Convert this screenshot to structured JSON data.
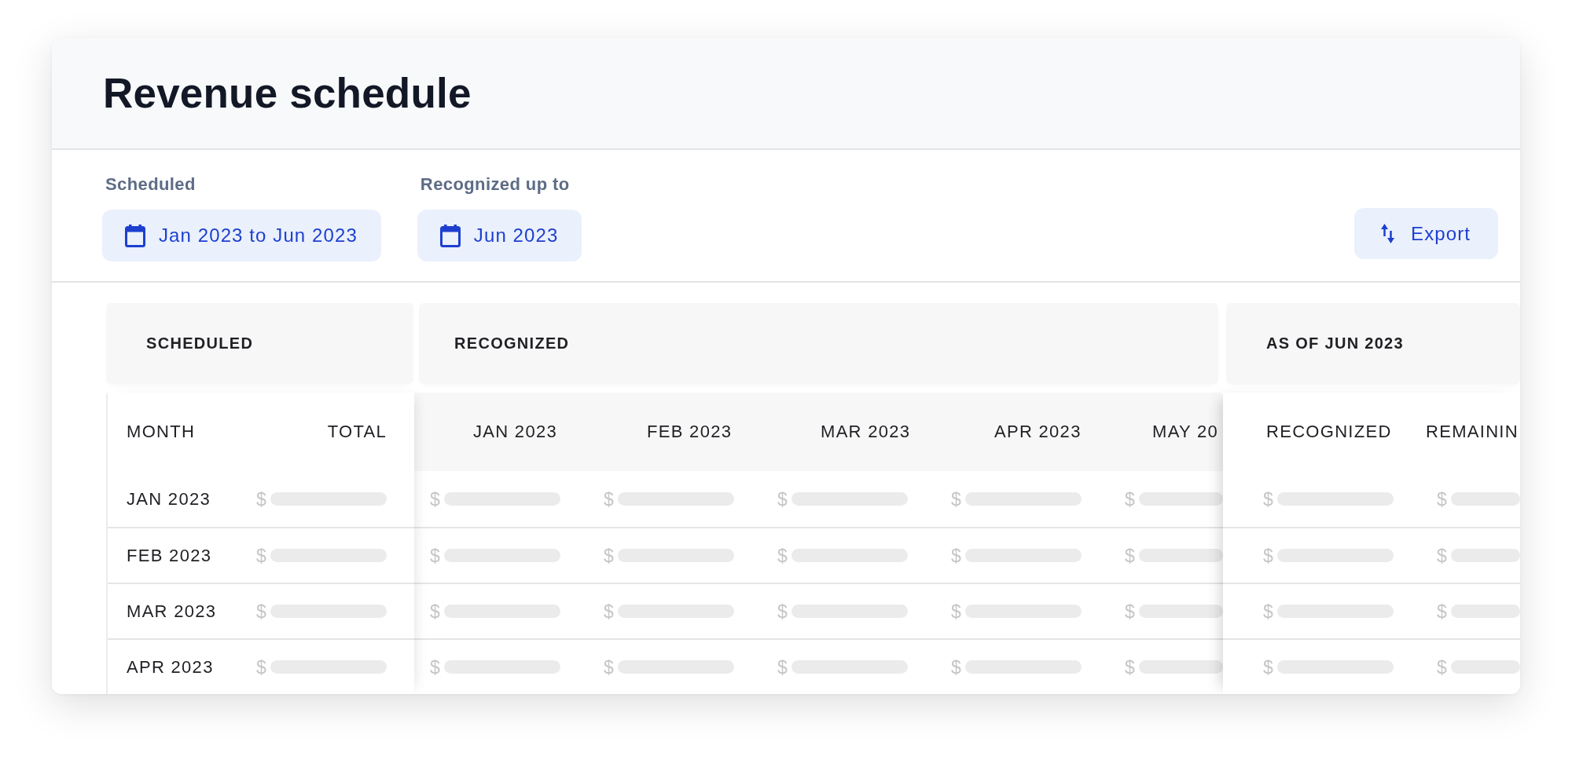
{
  "title": "Revenue schedule",
  "filters": [
    {
      "label": "Scheduled",
      "value": "Jan 2023 to Jun 2023"
    },
    {
      "label": "Recognized up to",
      "value": "Jun 2023"
    }
  ],
  "export_button": {
    "label": "Export"
  },
  "table": {
    "loading": true,
    "groups": [
      {
        "kind": "scheduled",
        "title": "SCHEDULED",
        "columns": [
          "MONTH",
          "TOTAL"
        ]
      },
      {
        "kind": "recognized",
        "title": "RECOGNIZED",
        "columns": [
          "JAN 2023",
          "FEB 2023",
          "MAR 2023",
          "APR 2023",
          "MAY 20"
        ]
      },
      {
        "kind": "as_of",
        "title": "AS OF JUN 2023",
        "columns": [
          "RECOGNIZED",
          "REMAININ"
        ]
      }
    ],
    "rows": [
      {
        "month": "JAN 2023",
        "cells": [
          "$",
          "$",
          "$",
          "$",
          "$",
          "$",
          "$",
          "$"
        ]
      },
      {
        "month": "FEB 2023",
        "cells": [
          "$",
          "$",
          "$",
          "$",
          "$",
          "$",
          "$",
          "$"
        ]
      },
      {
        "month": "MAR 2023",
        "cells": [
          "$",
          "$",
          "$",
          "$",
          "$",
          "$",
          "$",
          "$"
        ]
      },
      {
        "month": "APR 2023",
        "cells": [
          "$",
          "$",
          "$",
          "$",
          "$",
          "$",
          "$",
          "$"
        ]
      }
    ]
  }
}
